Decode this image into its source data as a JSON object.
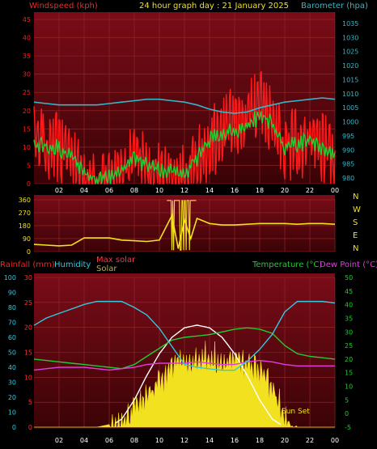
{
  "header": {
    "title": "24 hour graph day : 21 January 2025",
    "left_label": "Windspeed (kph)",
    "right_label": "Barometer (hpa)"
  },
  "colors": {
    "background": "#000000",
    "panel_top": "#7a0c18",
    "panel_bottom": "#3a0306",
    "grid": "#9a2a2a",
    "windspeed": "#ff1a1a",
    "gust": "#ff1a1a",
    "wind_avg": "#22cc33",
    "barometer": "#33b8c8",
    "direction": "#f2e11e",
    "rainfall": "#ff3030",
    "humidity": "#33c8e0",
    "max_solar": "#ff3344",
    "solar": "#f2e11e",
    "temperature": "#22cc33",
    "dew_point": "#e23ce0",
    "solar_fill": "#f2e11e",
    "max_solar_line": "#ffffff"
  },
  "chart_data": [
    {
      "type": "line",
      "title": "24 hour graph day : 21 January 2025",
      "x_ticks": [
        "02",
        "04",
        "06",
        "08",
        "10",
        "12",
        "14",
        "16",
        "18",
        "20",
        "22",
        "00"
      ],
      "hours": [
        0,
        1,
        2,
        3,
        4,
        5,
        6,
        7,
        8,
        9,
        10,
        11,
        12,
        13,
        14,
        15,
        16,
        17,
        18,
        19,
        20,
        21,
        22,
        23,
        24
      ],
      "left_axis": {
        "label": "Windspeed (kph)",
        "ticks": [
          0,
          5,
          10,
          15,
          20,
          25,
          30,
          35,
          40,
          45
        ],
        "ylim": [
          0,
          47
        ]
      },
      "right_axis": {
        "label": "Barometer (hpa)",
        "ticks": [
          980,
          985,
          990,
          995,
          1000,
          1005,
          1010,
          1015,
          1020,
          1025,
          1030,
          1035
        ],
        "ylim": [
          978,
          1039
        ]
      },
      "series": [
        {
          "name": "Windspeed (kph)",
          "axis": "left",
          "values": [
            17,
            16,
            15,
            13,
            6,
            4,
            5,
            7,
            12,
            10,
            7,
            7,
            6,
            11,
            16,
            19,
            22,
            24,
            27,
            23,
            15,
            16,
            17,
            15,
            11
          ]
        },
        {
          "name": "Wind average",
          "axis": "left",
          "values": [
            11,
            12,
            11,
            9,
            4,
            2,
            3,
            5,
            8,
            6,
            5,
            5,
            4,
            8,
            13,
            15,
            16,
            17,
            20,
            18,
            11,
            12,
            13,
            10,
            9
          ]
        },
        {
          "name": "Barometer (hpa)",
          "axis": "right",
          "values": [
            1007,
            1006.5,
            1006,
            1006,
            1006,
            1006,
            1006.5,
            1007,
            1007.5,
            1008,
            1008,
            1007.5,
            1007,
            1006,
            1004.5,
            1003.5,
            1003,
            1003.5,
            1005,
            1006,
            1007,
            1007.5,
            1008,
            1008.5,
            1008
          ]
        }
      ]
    },
    {
      "type": "line",
      "x_ticks": [],
      "left_axis": {
        "ticks": [
          0,
          90,
          180,
          270,
          360
        ],
        "ylim": [
          0,
          365
        ]
      },
      "right_axis": {
        "ticks": [
          "N",
          "W",
          "S",
          "E",
          "N"
        ]
      },
      "hours": [
        0,
        1,
        2,
        3,
        4,
        5,
        6,
        7,
        8,
        9,
        10,
        11,
        11.5,
        12,
        12.5,
        13,
        14,
        15,
        16,
        17,
        18,
        19,
        20,
        21,
        22,
        23,
        24
      ],
      "series": [
        {
          "name": "Wind direction",
          "values": [
            50,
            45,
            40,
            45,
            95,
            95,
            95,
            80,
            75,
            70,
            80,
            250,
            20,
            220,
            90,
            230,
            195,
            185,
            185,
            190,
            195,
            195,
            195,
            190,
            195,
            195,
            190
          ]
        }
      ]
    },
    {
      "type": "line",
      "legend": [
        "Rainfall (mm)",
        "Humidity",
        "Max solar",
        "Solar",
        "Temperature (°C)",
        "Dew Point (°C)"
      ],
      "x_ticks": [
        "02",
        "04",
        "06",
        "08",
        "10",
        "12",
        "14",
        "16",
        "18",
        "20",
        "22",
        "00"
      ],
      "hours": [
        0,
        1,
        2,
        3,
        4,
        5,
        6,
        7,
        8,
        9,
        10,
        11,
        12,
        13,
        14,
        15,
        16,
        17,
        18,
        19,
        20,
        21,
        22,
        23,
        24
      ],
      "axes": {
        "humidity": {
          "ticks": [
            0,
            10,
            20,
            30,
            40,
            50,
            60,
            70,
            80,
            90,
            100
          ],
          "ylim": [
            0,
            100
          ]
        },
        "rainfall": {
          "ticks": [
            0,
            5,
            10,
            15,
            20,
            25,
            30
          ],
          "ylim": [
            0,
            30
          ]
        },
        "temperature": {
          "ticks": [
            -5,
            0,
            5,
            10,
            15,
            20,
            25,
            30,
            35,
            40,
            45,
            50
          ],
          "ylim": [
            -5,
            50
          ]
        }
      },
      "series": [
        {
          "name": "Humidity",
          "axis": "humidity",
          "values": [
            68,
            73,
            76,
            79,
            82,
            84,
            84,
            84,
            80,
            75,
            66,
            54,
            42,
            40,
            39,
            38,
            38,
            44,
            52,
            62,
            77,
            84,
            84,
            84,
            83
          ]
        },
        {
          "name": "Temperature (°C)",
          "axis": "temperature",
          "values": [
            20,
            19.5,
            19,
            18.5,
            18,
            17.5,
            17,
            16.5,
            18,
            21,
            24,
            27,
            28,
            28.5,
            29,
            30,
            31,
            31.5,
            31,
            29.5,
            25,
            22,
            21,
            20.5,
            20
          ]
        },
        {
          "name": "Dew Point (°C)",
          "axis": "temperature",
          "values": [
            16,
            16.5,
            17,
            17,
            17,
            16.5,
            16,
            16.5,
            17,
            18,
            18.5,
            18.5,
            18.5,
            19,
            18.5,
            18,
            18,
            19,
            19.5,
            19,
            18,
            17.5,
            17.5,
            17.5,
            17.5
          ]
        },
        {
          "name": "Solar",
          "axis": "temperature",
          "values": [
            -5,
            -5,
            -5,
            -5,
            -5,
            -5,
            -4,
            1,
            4,
            8,
            14,
            19,
            22,
            24,
            24,
            23,
            22,
            20,
            18,
            12,
            2,
            -5,
            -5,
            -5,
            -5
          ]
        },
        {
          "name": "Max solar",
          "axis": "temperature",
          "values": [
            -5,
            -5,
            -5,
            -5,
            -5,
            -5,
            -5,
            -2,
            5,
            14,
            22,
            28,
            31.5,
            32.5,
            31.5,
            28,
            22,
            14,
            5,
            -2,
            -5,
            -5,
            -5,
            -5,
            -5
          ]
        }
      ],
      "annotation": "Sun Set"
    }
  ]
}
